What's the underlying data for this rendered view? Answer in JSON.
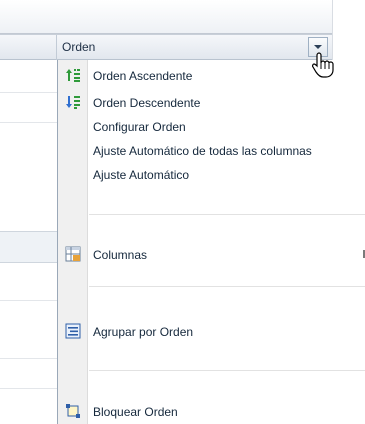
{
  "column_header": {
    "label": "Orden",
    "dropdown_icon": "chevron-down-icon"
  },
  "menu": {
    "sort_asc": {
      "label": "Orden Ascendente",
      "icon": "sort-ascending-icon"
    },
    "sort_desc": {
      "label": "Orden Descendente",
      "icon": "sort-descending-icon"
    },
    "configure_sort": {
      "label": "Configurar Orden"
    },
    "autofit_all": {
      "label": "Ajuste Automático de todas las columnas"
    },
    "autofit": {
      "label": "Ajuste Automático"
    },
    "columns": {
      "label": "Columnas",
      "icon": "columns-icon"
    },
    "group_by": {
      "label": "Agrupar por Orden",
      "icon": "group-icon"
    },
    "freeze": {
      "label": "Bloquear Orden",
      "icon": "freeze-icon"
    }
  },
  "colors": {
    "menu_gutter": "#f0f0f0",
    "header_border": "#b9c3cf",
    "icon_green": "#3aa43a",
    "icon_blue": "#2f6fd0"
  }
}
